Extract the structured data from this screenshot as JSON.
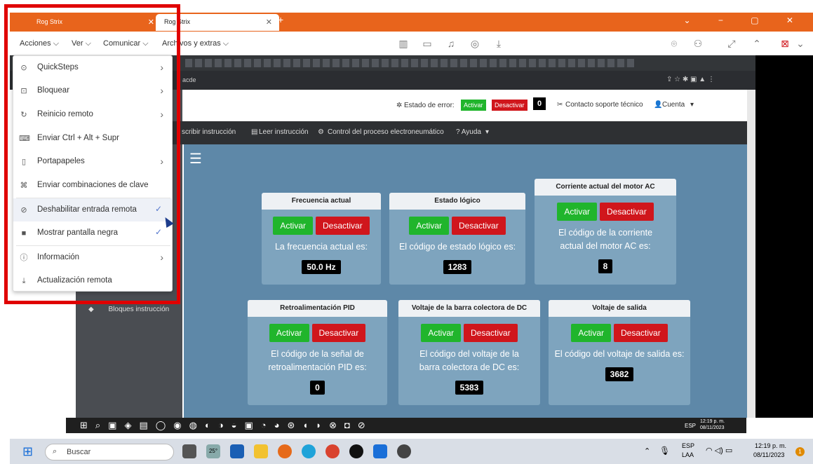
{
  "tv": {
    "tabs": [
      {
        "label": "Rog Strix"
      },
      {
        "label": "Rog Strix"
      }
    ],
    "menus": {
      "acciones": "Acciones",
      "ver": "Ver",
      "comunicar": "Comunicar",
      "archivos": "Archivos y extras"
    }
  },
  "dropdown": {
    "items": [
      {
        "label": "QuickSteps",
        "icon": "quicksteps-icon"
      },
      {
        "label": "Bloquear",
        "icon": "lock-icon"
      },
      {
        "label": "Reinicio remoto",
        "icon": "restart-icon"
      },
      {
        "label": "Enviar Ctrl + Alt + Supr",
        "icon": "keyboard-icon"
      },
      {
        "label": "Portapapeles",
        "icon": "clipboard-icon"
      },
      {
        "label": "Enviar combinaciones de clave",
        "icon": "key-combo-icon"
      },
      {
        "label": "Deshabilitar entrada remota",
        "icon": "disable-input-icon"
      },
      {
        "label": "Mostrar pantalla negra",
        "icon": "black-screen-icon"
      },
      {
        "label": "Información",
        "icon": "info-icon"
      },
      {
        "label": "Actualización remota",
        "icon": "download-icon"
      }
    ]
  },
  "remote": {
    "address_fragment": "acde",
    "header": {
      "estado_error": "Estado de error:",
      "activar": "Activar",
      "desactivar": "Desactivar",
      "error_count": "0",
      "contacto": "Contacto soporte técnico",
      "cuenta": "Cuenta"
    },
    "nav": {
      "escribir": "scribir instrucción",
      "leer": "Leer instrucción",
      "control": "Control del proceso electroneumático",
      "ayuda": "? Ayuda"
    },
    "sidebar_item": "Bloques instrucción",
    "cards": [
      {
        "title": "Frecuencia actual",
        "activar": "Activar",
        "desactivar": "Desactivar",
        "text": "La frecuencia actual es:",
        "value": "50.0 Hz"
      },
      {
        "title": "Estado lógico",
        "activar": "Activar",
        "desactivar": "Desactivar",
        "text": "El código de estado lógico es:",
        "value": "1283"
      },
      {
        "title": "Corriente actual del motor AC",
        "activar": "Activar",
        "desactivar": "Desactivar",
        "text": "El código de la corriente actual del motor AC es:",
        "value": "8"
      },
      {
        "title": "Retroalimentación PID",
        "activar": "Activar",
        "desactivar": "Desactivar",
        "text": "El código de la señal de retroalimentación PID es:",
        "value": "0"
      },
      {
        "title": "Voltaje de la barra colectora de DC",
        "activar": "Activar",
        "desactivar": "Desactivar",
        "text": "El código del voltaje de la barra colectora de DC es:",
        "value": "5383"
      },
      {
        "title": "Voltaje de salida",
        "activar": "Activar",
        "desactivar": "Desactivar",
        "text": "El código del voltaje de salida es:",
        "value": "3682"
      }
    ],
    "taskbar": {
      "lang": "ESP",
      "time": "12:19 p. m.",
      "date": "08/11/2023"
    }
  },
  "taskbar": {
    "search_placeholder": "Buscar",
    "lang": "ESP",
    "lang2": "LAA",
    "time": "12:19 p. m.",
    "date": "08/11/2023",
    "weather": "25°",
    "notification_count": "1"
  }
}
